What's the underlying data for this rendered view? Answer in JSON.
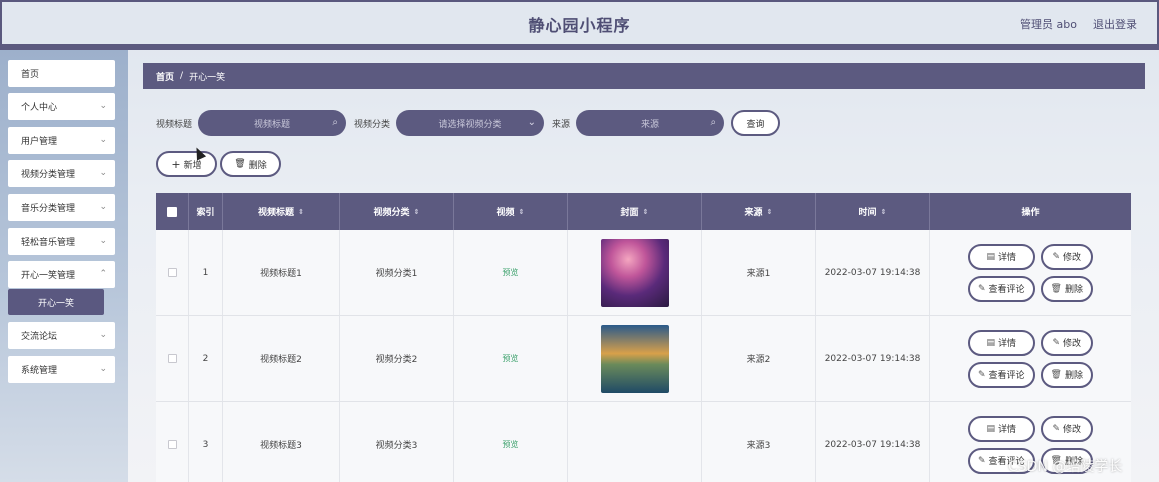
{
  "app": {
    "title": "静心园小程序",
    "admin_label": "管理员 abo",
    "logout": "退出登录"
  },
  "sidebar": {
    "items": [
      {
        "label": "首页",
        "chevron": false
      },
      {
        "label": "个人中心",
        "chevron": true
      },
      {
        "label": "用户管理",
        "chevron": true
      },
      {
        "label": "视频分类管理",
        "chevron": true
      },
      {
        "label": "音乐分类管理",
        "chevron": true
      },
      {
        "label": "轻松音乐管理",
        "chevron": true
      },
      {
        "label": "开心一笑管理",
        "chevron": true
      },
      {
        "label": "交流论坛",
        "chevron": true
      },
      {
        "label": "系统管理",
        "chevron": true
      }
    ],
    "active_sub": "开心一笑"
  },
  "breadcrumb": {
    "home": "首页",
    "separator": "/",
    "current": "开心一笑"
  },
  "search": {
    "title_label": "视频标题",
    "title_placeholder": "视频标题",
    "category_label": "视频分类",
    "category_placeholder": "请选择视频分类",
    "source_label": "来源",
    "source_placeholder": "来源",
    "query_button": "查询"
  },
  "actions": {
    "add": "新增",
    "delete": "删除"
  },
  "table": {
    "headers": [
      "索引",
      "视频标题",
      "视频分类",
      "视频",
      "封面",
      "来源",
      "时间",
      "操作"
    ],
    "preview_text": "预览",
    "op_labels": {
      "detail": "详情",
      "edit": "修改",
      "comments": "查看评论",
      "delete": "删除"
    },
    "rows": [
      {
        "index": "1",
        "title": "视频标题1",
        "category": "视频分类1",
        "source": "来源1",
        "time": "2022-03-07 19:14:38",
        "cover": "cover-purple-sky"
      },
      {
        "index": "2",
        "title": "视频标题2",
        "category": "视频分类2",
        "source": "来源2",
        "time": "2022-03-07 19:14:38",
        "cover": "cover-island-castle"
      },
      {
        "index": "3",
        "title": "视频标题3",
        "category": "视频分类3",
        "source": "来源3",
        "time": "2022-03-07 19:14:38",
        "cover": ""
      }
    ]
  },
  "watermark": "CSDN @培陵学长",
  "colors": {
    "primary": "#5c5a80",
    "preview": "#3aa06a",
    "header_bg": "#e1e7ef"
  }
}
